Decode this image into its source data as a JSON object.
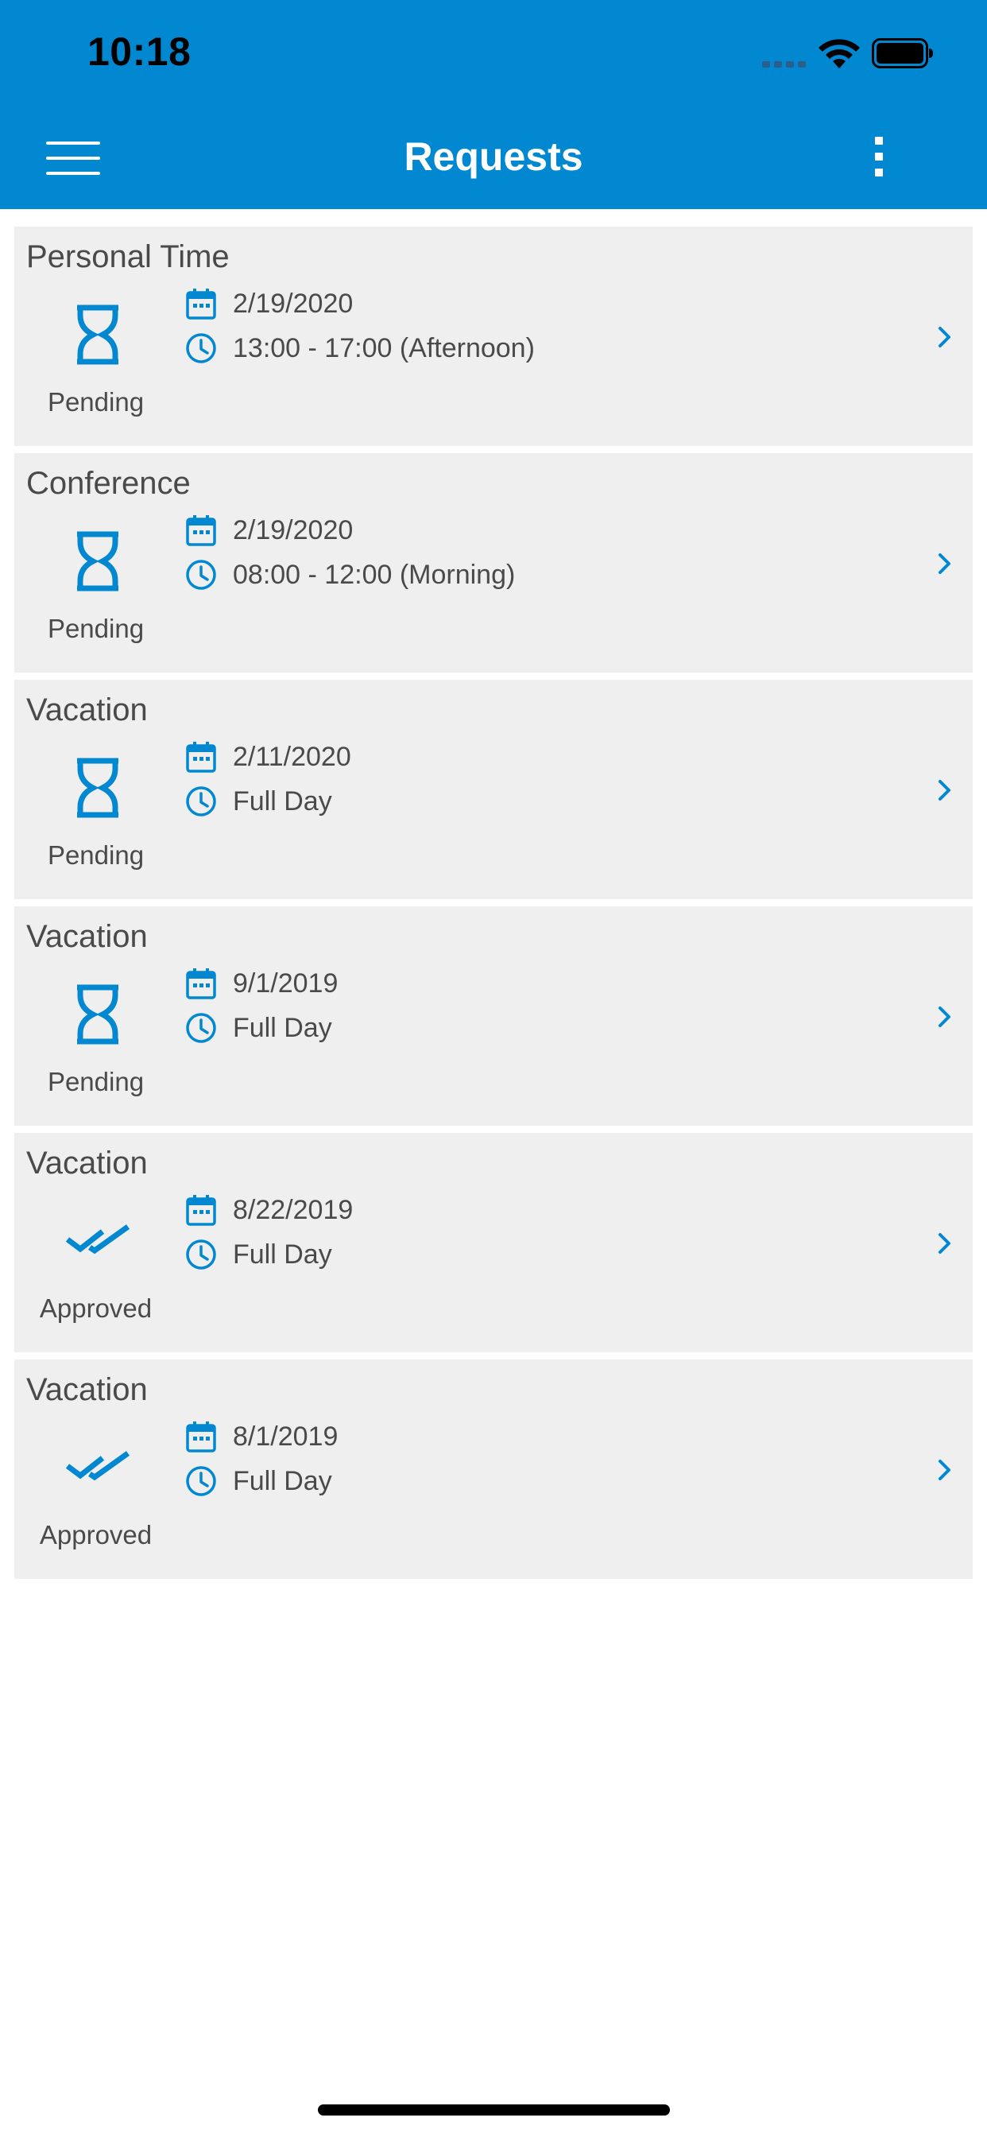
{
  "status_bar": {
    "time": "10:18"
  },
  "header": {
    "title": "Requests",
    "background_color": "#0288d1",
    "menu_icon": "hamburger-menu-icon",
    "more_icon": "vertical-dots-icon"
  },
  "colors": {
    "accent": "#0288d1",
    "card_background": "#f0efef",
    "text": "#4a4a4a"
  },
  "requests": [
    {
      "title": "Personal Time",
      "status": "Pending",
      "status_icon": "hourglass-icon",
      "date": "2/19/2020",
      "time": "13:00 - 17:00 (Afternoon)"
    },
    {
      "title": "Conference",
      "status": "Pending",
      "status_icon": "hourglass-icon",
      "date": "2/19/2020",
      "time": "08:00 - 12:00 (Morning)"
    },
    {
      "title": "Vacation",
      "status": "Pending",
      "status_icon": "hourglass-icon",
      "date": "2/11/2020",
      "time": "Full Day"
    },
    {
      "title": "Vacation",
      "status": "Pending",
      "status_icon": "hourglass-icon",
      "date": "9/1/2019",
      "time": "Full Day"
    },
    {
      "title": "Vacation",
      "status": "Approved",
      "status_icon": "double-check-icon",
      "date": "8/22/2019",
      "time": "Full Day"
    },
    {
      "title": "Vacation",
      "status": "Approved",
      "status_icon": "double-check-icon",
      "date": "8/1/2019",
      "time": "Full Day"
    }
  ]
}
